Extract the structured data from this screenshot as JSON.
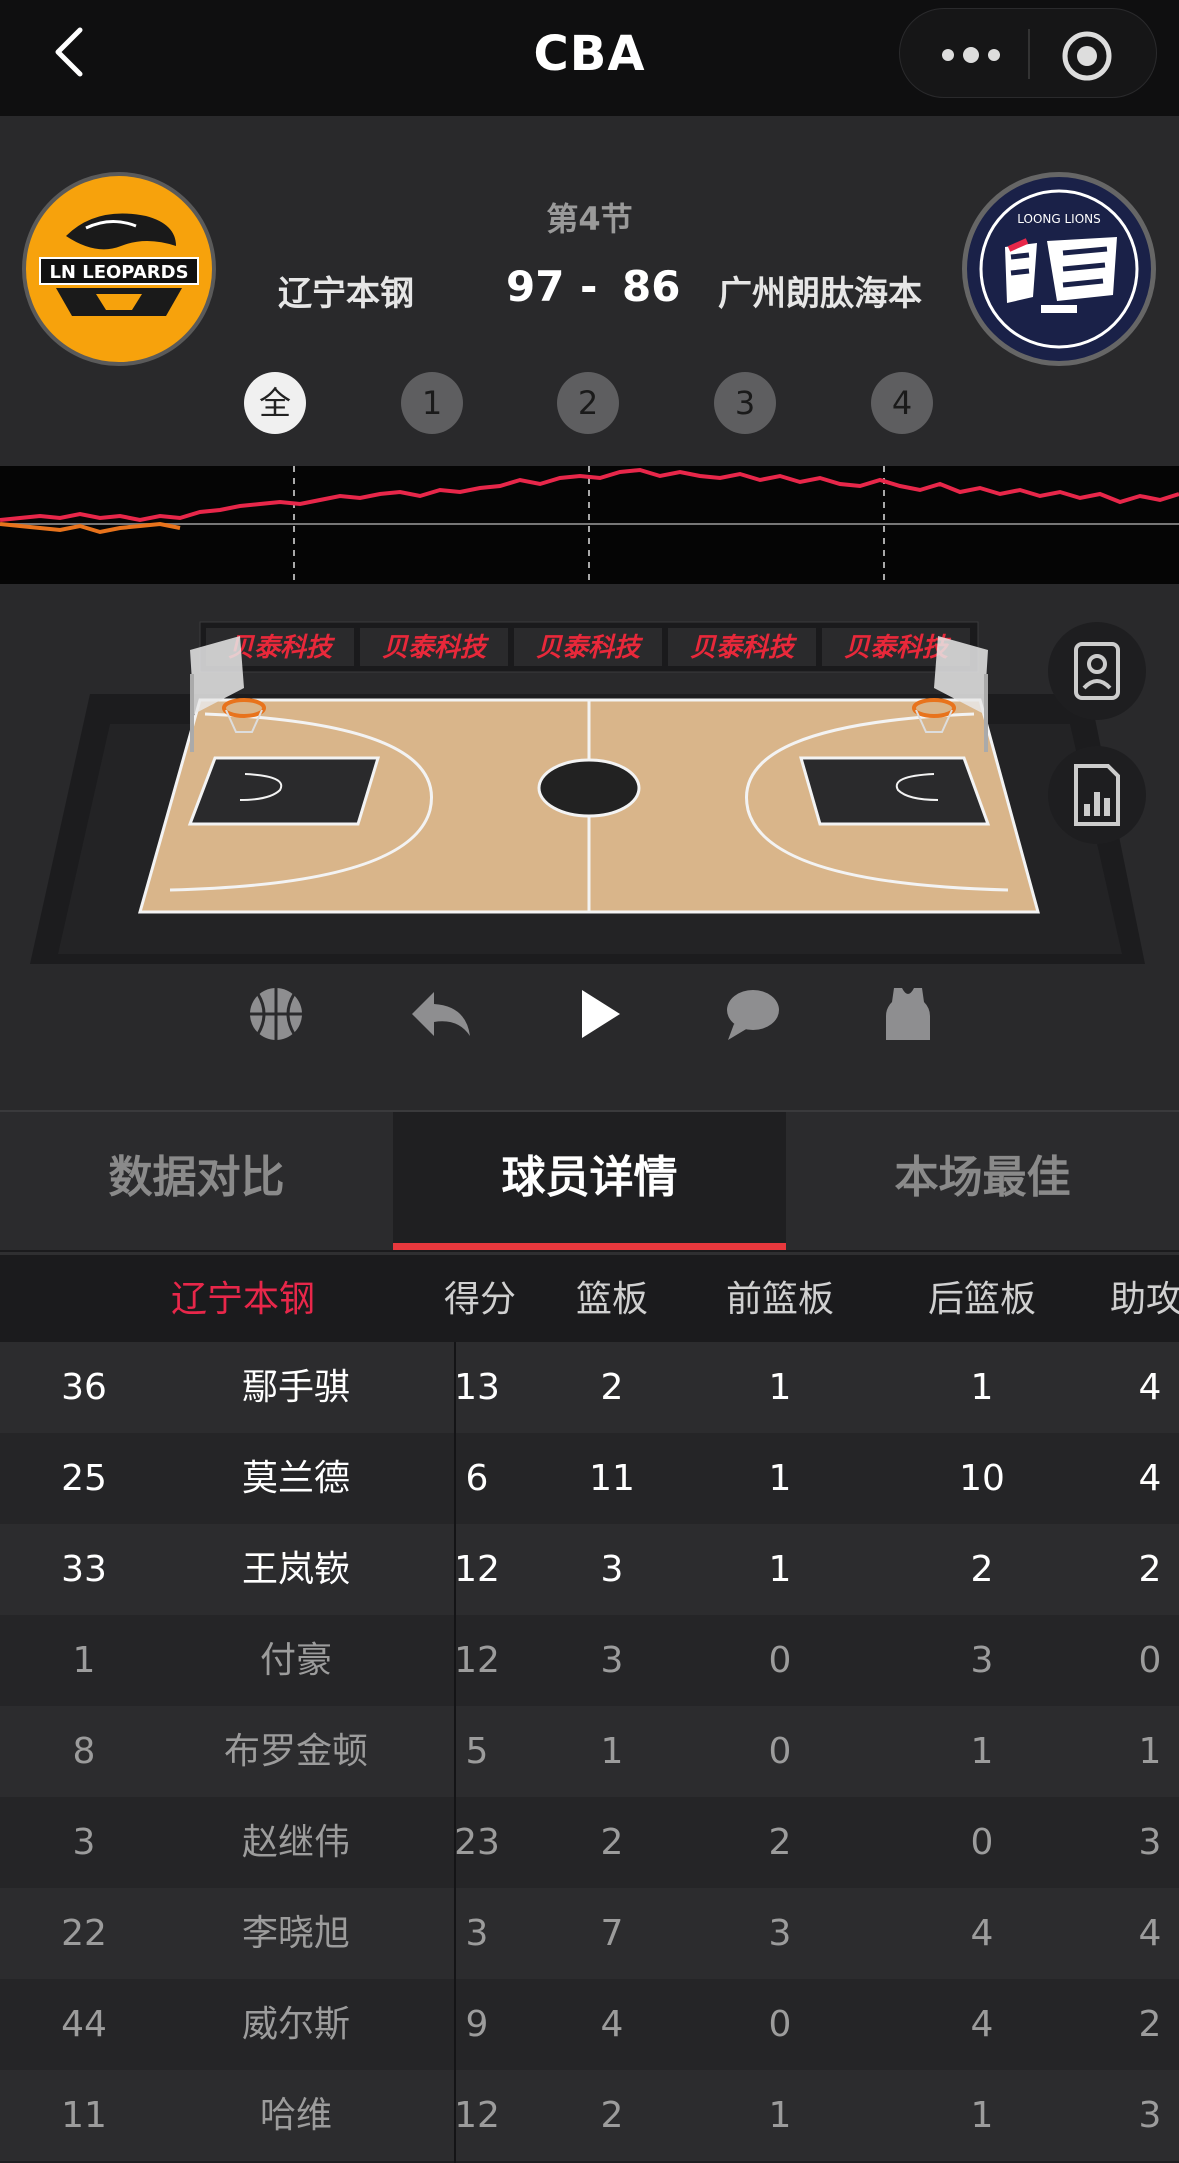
{
  "header": {
    "title": "CBA"
  },
  "game": {
    "period": "第4节",
    "home_team": "辽宁本钢",
    "away_team": "广州朗肽海本",
    "home_score": "97",
    "separator": "-",
    "away_score": "86",
    "home_logo_text": "LN LEOPARDS",
    "away_logo_text": "LOONG LIONS"
  },
  "quarter_tabs": [
    "全",
    "1",
    "2",
    "3",
    "4"
  ],
  "ad_banner": "贝泰科技",
  "tabs": {
    "compare": "数据对比",
    "players": "球员详情",
    "best": "本场最佳"
  },
  "table": {
    "team_label": "辽宁本钢",
    "headers": [
      "得分",
      "篮板",
      "前篮板",
      "后篮板",
      "助攻"
    ],
    "rows": [
      {
        "num": "36",
        "name": "鄢手骐",
        "pts": "13",
        "reb": "2",
        "oreb": "1",
        "dreb": "1",
        "ast": "4",
        "starter": true
      },
      {
        "num": "25",
        "name": "莫兰德",
        "pts": "6",
        "reb": "11",
        "oreb": "1",
        "dreb": "10",
        "ast": "4",
        "starter": true
      },
      {
        "num": "33",
        "name": "王岚嵚",
        "pts": "12",
        "reb": "3",
        "oreb": "1",
        "dreb": "2",
        "ast": "2",
        "starter": true
      },
      {
        "num": "1",
        "name": "付豪",
        "pts": "12",
        "reb": "3",
        "oreb": "0",
        "dreb": "3",
        "ast": "0",
        "starter": false
      },
      {
        "num": "8",
        "name": "布罗金顿",
        "pts": "5",
        "reb": "1",
        "oreb": "0",
        "dreb": "1",
        "ast": "1",
        "starter": false
      },
      {
        "num": "3",
        "name": "赵继伟",
        "pts": "23",
        "reb": "2",
        "oreb": "2",
        "dreb": "0",
        "ast": "3",
        "starter": false
      },
      {
        "num": "22",
        "name": "李晓旭",
        "pts": "3",
        "reb": "7",
        "oreb": "3",
        "dreb": "4",
        "ast": "4",
        "starter": false
      },
      {
        "num": "44",
        "name": "威尔斯",
        "pts": "9",
        "reb": "4",
        "oreb": "0",
        "dreb": "4",
        "ast": "2",
        "starter": false
      },
      {
        "num": "11",
        "name": "哈维",
        "pts": "12",
        "reb": "2",
        "oreb": "1",
        "dreb": "1",
        "ast": "3",
        "starter": false
      }
    ]
  },
  "colors": {
    "accent": "#e8383d",
    "team_red": "#e8274a",
    "home_orange": "#f7a20c",
    "away_navy": "#1a2148"
  },
  "icons": [
    "back-icon",
    "more-dots-icon",
    "record-icon",
    "player-card-icon",
    "stats-chart-icon",
    "basketball-icon",
    "replay-icon",
    "play-icon",
    "comment-icon",
    "jersey-icon"
  ]
}
